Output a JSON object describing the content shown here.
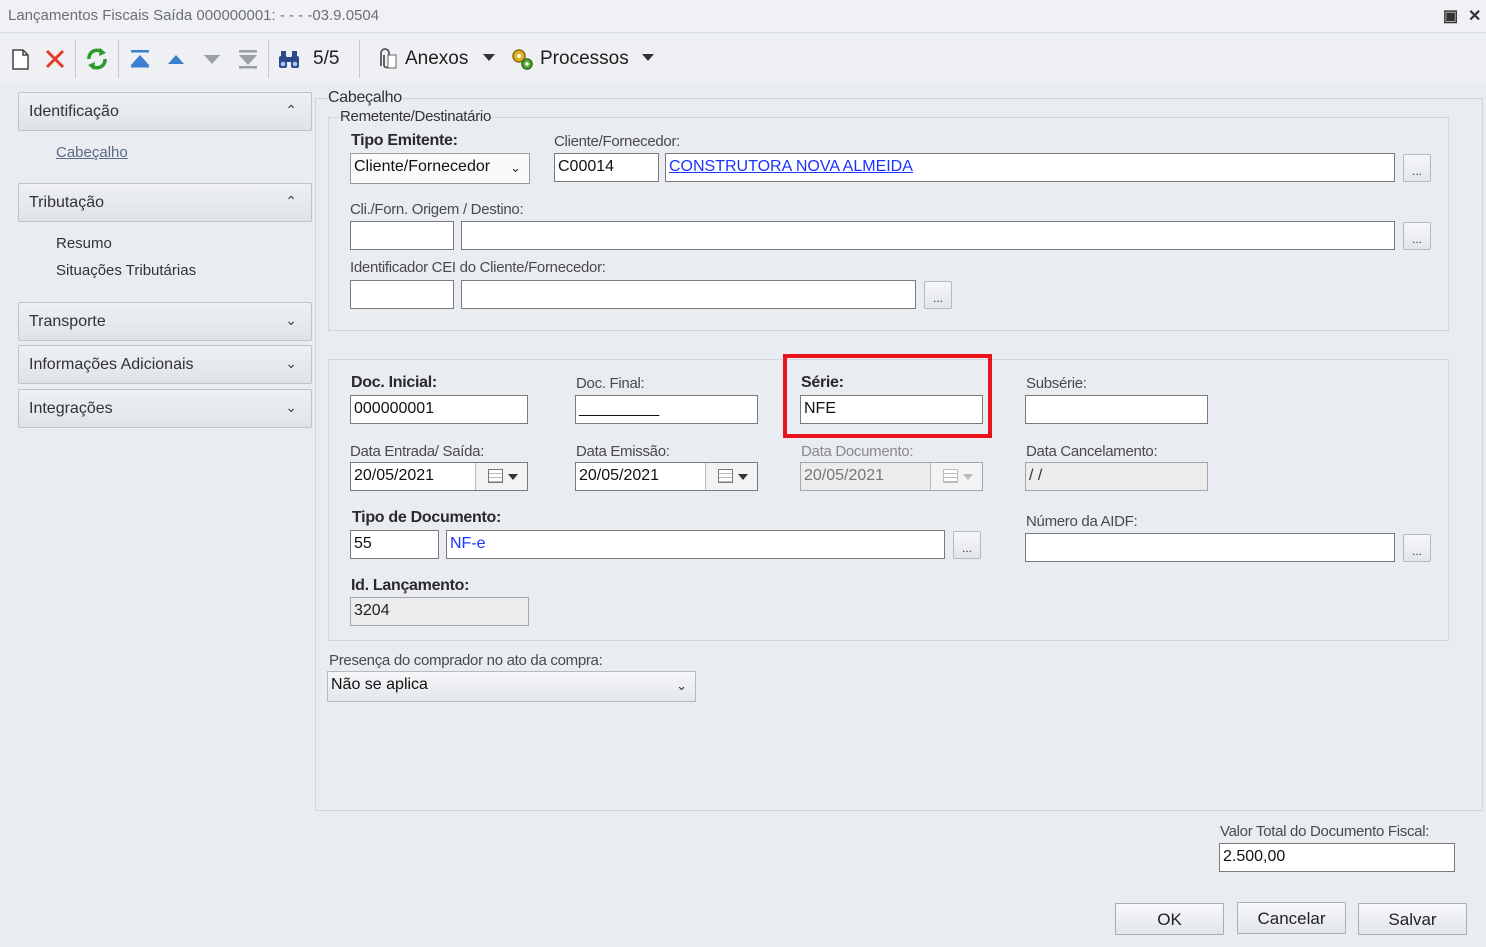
{
  "window": {
    "title": "Lançamentos Fiscais Saída 000000001: - - - -03.9.0504",
    "restore_icon": "window-restore-icon",
    "close_icon": "window-close-icon"
  },
  "toolbar": {
    "record_counter": "5/5",
    "attachments_label": "Anexos",
    "processes_label": "Processos"
  },
  "sidebar": {
    "groups": [
      {
        "label": "Identificação",
        "expanded": true,
        "items": [
          "Cabeçalho"
        ]
      },
      {
        "label": "Tributação",
        "expanded": true,
        "items": [
          "Resumo",
          "Situações Tributárias"
        ]
      },
      {
        "label": "Transporte",
        "expanded": false
      },
      {
        "label": "Informações Adicionais",
        "expanded": false
      },
      {
        "label": "Integrações",
        "expanded": false
      }
    ]
  },
  "header": {
    "section_title": "Cabeçalho",
    "group_title": "Remetente/Destinatário",
    "tipo_emitente_label": "Tipo Emitente:",
    "tipo_emitente_value": "Cliente/Fornecedor",
    "cliente_label": "Cliente/Fornecedor:",
    "cliente_code": "C00014",
    "cliente_name": "CONSTRUTORA NOVA ALMEIDA",
    "origem_label": "Cli./Forn. Origem / Destino:",
    "origem_code": "",
    "origem_name": "",
    "cei_label": "Identificador CEI do Cliente/Fornecedor:",
    "cei_code": "",
    "cei_name": ""
  },
  "document": {
    "doc_inicial_label": "Doc. Inicial:",
    "doc_inicial_value": "000000001",
    "doc_final_label": "Doc. Final:",
    "doc_final_value": "_________",
    "serie_label": "Série:",
    "serie_value": "NFE",
    "subserie_label": "Subsérie:",
    "subserie_value": "",
    "data_entrada_label": "Data Entrada/ Saída:",
    "data_entrada_value": "20/05/2021",
    "data_emissao_label": "Data Emissão:",
    "data_emissao_value": "20/05/2021",
    "data_documento_label": "Data Documento:",
    "data_documento_value": "20/05/2021",
    "data_cancelamento_label": "Data Cancelamento:",
    "data_cancelamento_value": " / /",
    "tipo_documento_label": "Tipo de Documento:",
    "tipo_documento_code": "55",
    "tipo_documento_name": "NF-e",
    "numero_aidf_label": "Número da AIDF:",
    "numero_aidf_value": "",
    "id_lancamento_label": "Id. Lançamento:",
    "id_lancamento_value": "3204"
  },
  "presenca": {
    "label": "Presença do comprador no ato da compra:",
    "value": "Não se aplica"
  },
  "total": {
    "label": "Valor Total do Documento Fiscal:",
    "value": "2.500,00"
  },
  "buttons": {
    "ok": "OK",
    "cancel": "Cancelar",
    "save": "Salvar"
  },
  "ellipsis": "...",
  "colors": {
    "highlight": "#e8131b",
    "link": "#1a33ff",
    "background": "#e9ecf1"
  }
}
